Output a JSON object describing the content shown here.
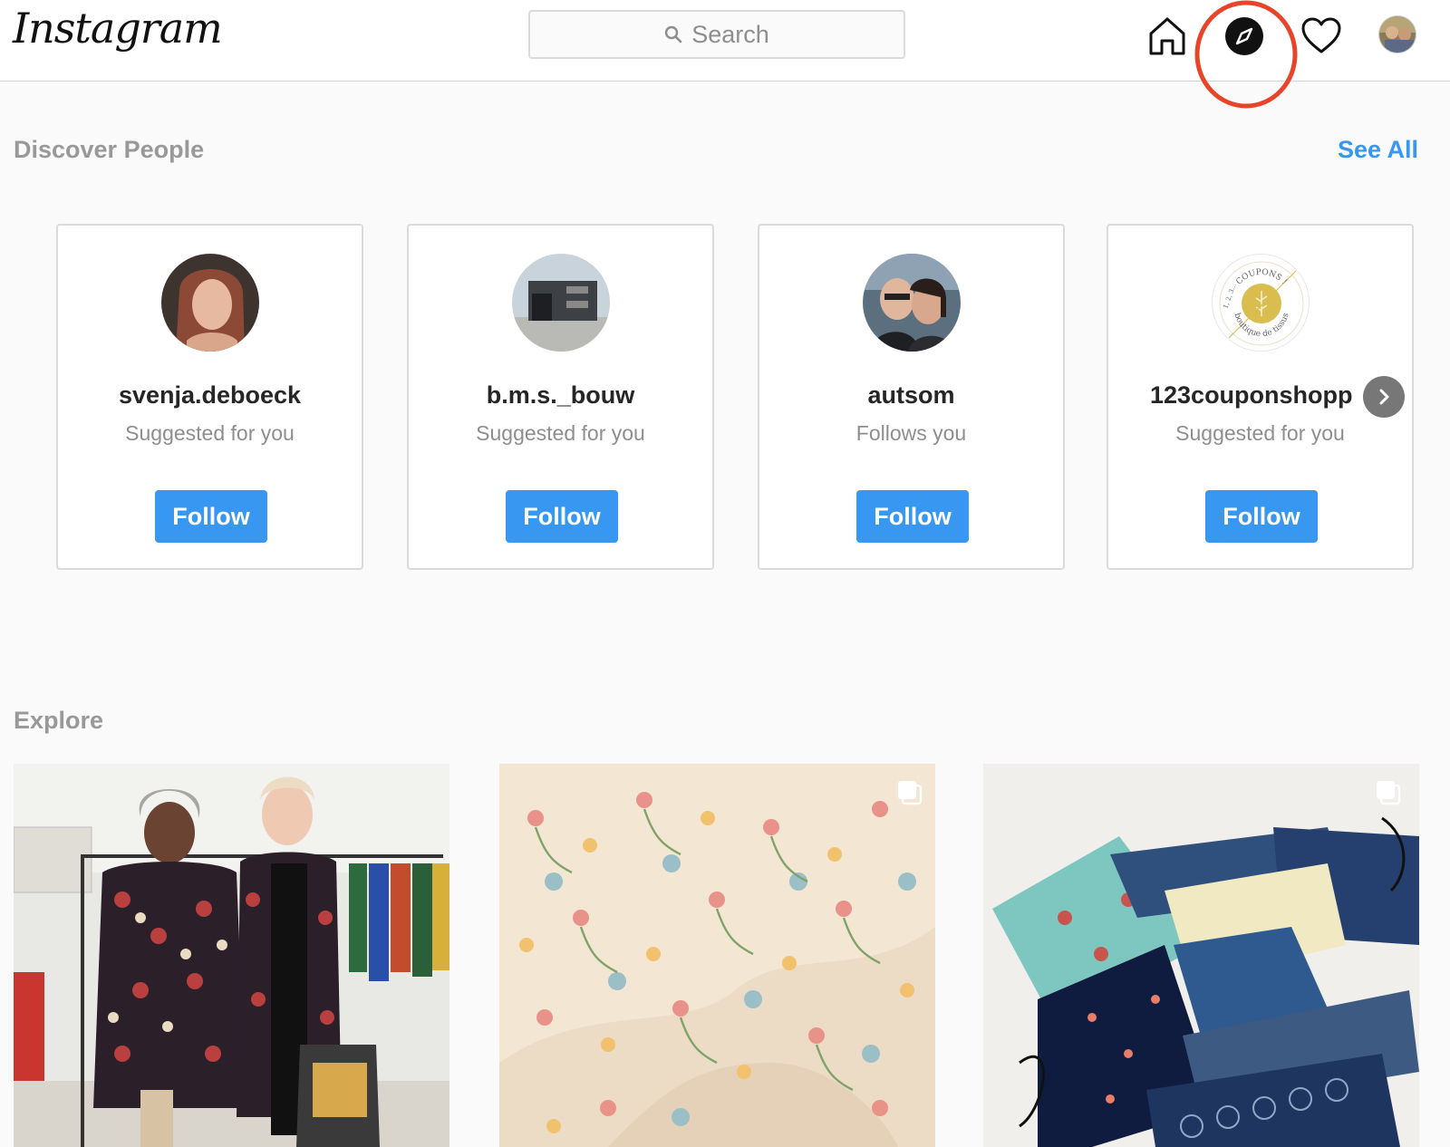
{
  "app": {
    "logo": "Instagram"
  },
  "search": {
    "placeholder": "Search"
  },
  "nav": {
    "icons": [
      "home-icon",
      "explore-compass-icon",
      "activity-heart-icon",
      "profile-avatar"
    ]
  },
  "discover": {
    "title": "Discover People",
    "see_all": "See All",
    "cards": [
      {
        "username": "svenja.deboeck",
        "subtitle": "Suggested for you",
        "button": "Follow"
      },
      {
        "username": "b.m.s._bouw",
        "subtitle": "Suggested for you",
        "button": "Follow"
      },
      {
        "username": "autsom",
        "subtitle": "Follows you",
        "button": "Follow"
      },
      {
        "username": "123couponshopp",
        "subtitle": "Suggested for you",
        "button": "Follow"
      }
    ],
    "coupon_logo": {
      "top": "COUPONS !",
      "left": "1, 2, 3...",
      "bottom": "boutique de tissus"
    }
  },
  "explore": {
    "title": "Explore"
  },
  "colors": {
    "accent": "#3897f0",
    "annotation": "#e8442a"
  }
}
